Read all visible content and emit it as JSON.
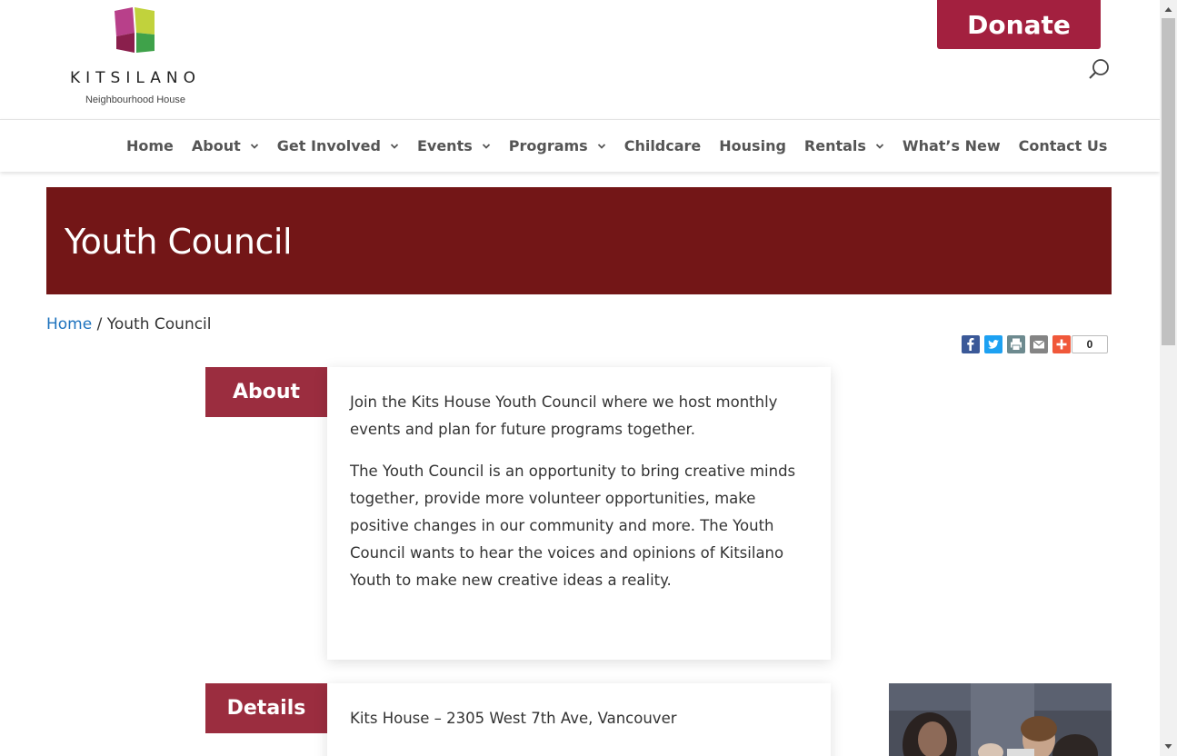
{
  "header": {
    "logo_text": "KITSILANO",
    "logo_sub": "Neighbourhood House",
    "donate_label": "Donate"
  },
  "nav": {
    "items": [
      {
        "label": "Home",
        "dropdown": false
      },
      {
        "label": "About",
        "dropdown": true
      },
      {
        "label": "Get Involved",
        "dropdown": true
      },
      {
        "label": "Events",
        "dropdown": true
      },
      {
        "label": "Programs",
        "dropdown": true
      },
      {
        "label": "Childcare",
        "dropdown": false
      },
      {
        "label": "Housing",
        "dropdown": false
      },
      {
        "label": "Rentals",
        "dropdown": true
      },
      {
        "label": "What’s New",
        "dropdown": false
      },
      {
        "label": "Contact Us",
        "dropdown": false
      }
    ]
  },
  "page": {
    "title": "Youth Council",
    "breadcrumb_home": "Home",
    "breadcrumb_sep": " / ",
    "breadcrumb_current": "Youth Council"
  },
  "share": {
    "icons": [
      "facebook-icon",
      "twitter-icon",
      "print-icon",
      "email-icon",
      "add-share-icon"
    ],
    "count": "0"
  },
  "about": {
    "tab_label": "About",
    "paragraphs": [
      "Join the Kits House Youth Council where we host monthly events and plan for future programs together.",
      "The Youth Council is an opportunity to bring creative minds together, provide more volunteer opportunities, make positive changes in our community and more. The Youth Council wants to hear the voices and opinions of Kitsilano Youth to make new creative ideas a reality."
    ]
  },
  "details": {
    "tab_label": "Details",
    "location": "Kits House – 2305 West 7th Ave, Vancouver"
  },
  "colors": {
    "donate": "#a3203f",
    "banner": "#731617",
    "tab": "#9b2d3f",
    "link": "#1e73be"
  }
}
